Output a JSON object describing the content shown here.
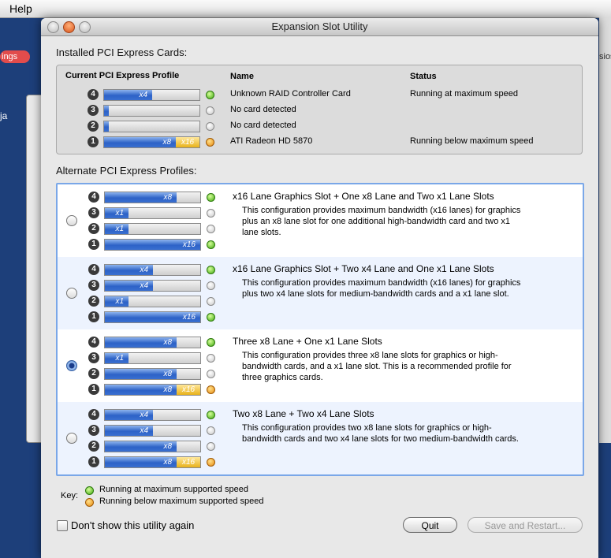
{
  "menubar": {
    "help": "Help"
  },
  "background": {
    "badge": "ings",
    "snippet_right": "sios",
    "snippet_left": "ja"
  },
  "window": {
    "title": "Expansion Slot Utility",
    "installed_label": "Installed PCI Express Cards:",
    "installed": {
      "headers": {
        "profile": "Current PCI Express Profile",
        "name": "Name",
        "status": "Status"
      },
      "rows": [
        {
          "slot": "4",
          "lane": "x4",
          "fill": 0.5,
          "status_dot": "green",
          "name": "Unknown RAID Controller Card",
          "status": "Running at maximum speed"
        },
        {
          "slot": "3",
          "lane": "",
          "fill": 0,
          "status_dot": "empty",
          "name": "No card detected",
          "status": ""
        },
        {
          "slot": "2",
          "lane": "",
          "fill": 0,
          "status_dot": "empty",
          "name": "No card detected",
          "status": ""
        },
        {
          "slot": "1",
          "lane": "x8",
          "extra": "x16",
          "fill": 0.75,
          "status_dot": "orange",
          "name": "ATI Radeon HD 5870",
          "status": "Running below maximum speed"
        }
      ]
    },
    "alt_label": "Alternate PCI Express Profiles:",
    "profiles": [
      {
        "title": "x16 Lane Graphics Slot + One x8 Lane and Two x1 Lane Slots",
        "desc_lines": [
          "This configuration provides maximum bandwidth (x16 lanes) for graphics",
          "plus an x8 lane slot for one additional high-bandwidth card and two x1",
          "lane slots."
        ],
        "selected": false,
        "slots": [
          {
            "slot": "4",
            "lane": "x8",
            "fill": 0.75,
            "dot": "green"
          },
          {
            "slot": "3",
            "lane": "x1",
            "fill": 0.25,
            "dot": "empty"
          },
          {
            "slot": "2",
            "lane": "x1",
            "fill": 0.25,
            "dot": "empty"
          },
          {
            "slot": "1",
            "lane": "x16",
            "fill": 1.0,
            "dot": "green"
          }
        ]
      },
      {
        "title": "x16 Lane Graphics Slot + Two x4 Lane and One x1 Lane Slots",
        "desc_lines": [
          "This configuration provides maximum bandwidth (x16 lanes) for graphics",
          "plus two x4 lane slots for medium-bandwidth cards and a x1 lane slot."
        ],
        "selected": false,
        "slots": [
          {
            "slot": "4",
            "lane": "x4",
            "fill": 0.5,
            "dot": "green"
          },
          {
            "slot": "3",
            "lane": "x4",
            "fill": 0.5,
            "dot": "empty"
          },
          {
            "slot": "2",
            "lane": "x1",
            "fill": 0.25,
            "dot": "empty"
          },
          {
            "slot": "1",
            "lane": "x16",
            "fill": 1.0,
            "dot": "green"
          }
        ]
      },
      {
        "title": "Three x8 Lane + One x1 Lane Slots",
        "desc_lines": [
          "This configuration provides three x8 lane slots for graphics or high-",
          "bandwidth cards, and a x1 lane slot.  This is a recommended profile for",
          "three graphics cards."
        ],
        "selected": true,
        "slots": [
          {
            "slot": "4",
            "lane": "x8",
            "fill": 0.75,
            "dot": "green"
          },
          {
            "slot": "3",
            "lane": "x1",
            "fill": 0.25,
            "dot": "empty"
          },
          {
            "slot": "2",
            "lane": "x8",
            "fill": 0.75,
            "dot": "empty"
          },
          {
            "slot": "1",
            "lane": "x8",
            "extra": "x16",
            "fill": 0.75,
            "dot": "orange"
          }
        ]
      },
      {
        "title": "Two x8 Lane + Two x4 Lane Slots",
        "desc_lines": [
          "This configuration provides two x8 lane slots for graphics or high-",
          "bandwidth cards and two x4 lane slots for two medium-bandwidth cards."
        ],
        "selected": false,
        "slots": [
          {
            "slot": "4",
            "lane": "x4",
            "fill": 0.5,
            "dot": "green"
          },
          {
            "slot": "3",
            "lane": "x4",
            "fill": 0.5,
            "dot": "empty"
          },
          {
            "slot": "2",
            "lane": "x8",
            "fill": 0.75,
            "dot": "empty"
          },
          {
            "slot": "1",
            "lane": "x8",
            "extra": "x16",
            "fill": 0.75,
            "dot": "orange"
          }
        ]
      }
    ],
    "key": {
      "label": "Key:",
      "green": "Running at maximum supported speed",
      "orange": "Running below maximum supported speed"
    },
    "dont_show": "Don't show this utility again",
    "quit": "Quit",
    "save": "Save and Restart..."
  }
}
